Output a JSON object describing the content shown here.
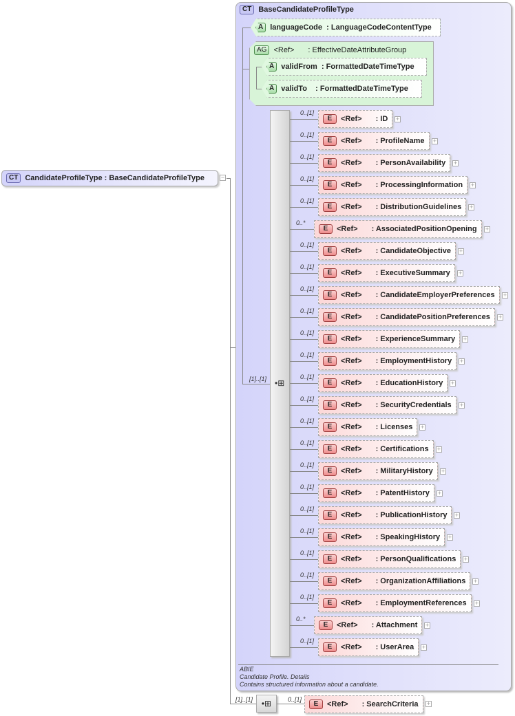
{
  "root": {
    "badge": "CT",
    "name": "CandidateProfileType",
    "type": "BaseCandidateProfileType"
  },
  "complex_type": {
    "badge": "CT",
    "title": "BaseCandidateProfileType"
  },
  "attribute": {
    "badge": "A",
    "name": "languageCode",
    "type": ": LanguageCodeContentType"
  },
  "attribute_group": {
    "badge": "AG",
    "ref": "<Ref>",
    "type": ": EffectiveDateAttributeGroup",
    "attributes": [
      {
        "badge": "A",
        "name": "validFrom",
        "type": ": FormattedDateTimeType"
      },
      {
        "badge": "A",
        "name": "validTo",
        "type": ": FormattedDateTimeType"
      }
    ]
  },
  "sequence": {
    "cardinality": "[1]..[1]"
  },
  "elements": [
    {
      "card": "0..[1]",
      "name": ": ID"
    },
    {
      "card": "0..[1]",
      "name": ": ProfileName"
    },
    {
      "card": "0..[1]",
      "name": ": PersonAvailability"
    },
    {
      "card": "0..[1]",
      "name": ": ProcessingInformation"
    },
    {
      "card": "0..[1]",
      "name": ": DistributionGuidelines"
    },
    {
      "card": "0..*",
      "name": ": AssociatedPositionOpening"
    },
    {
      "card": "0..[1]",
      "name": ": CandidateObjective"
    },
    {
      "card": "0..[1]",
      "name": ": ExecutiveSummary"
    },
    {
      "card": "0..[1]",
      "name": ": CandidateEmployerPreferences"
    },
    {
      "card": "0..[1]",
      "name": ": CandidatePositionPreferences"
    },
    {
      "card": "0..[1]",
      "name": ": ExperienceSummary"
    },
    {
      "card": "0..[1]",
      "name": ": EmploymentHistory"
    },
    {
      "card": "0..[1]",
      "name": ": EducationHistory"
    },
    {
      "card": "0..[1]",
      "name": ": SecurityCredentials"
    },
    {
      "card": "0..[1]",
      "name": ": Licenses"
    },
    {
      "card": "0..[1]",
      "name": ": Certifications"
    },
    {
      "card": "0..[1]",
      "name": ": MilitaryHistory"
    },
    {
      "card": "0..[1]",
      "name": ": PatentHistory"
    },
    {
      "card": "0..[1]",
      "name": ": PublicationHistory"
    },
    {
      "card": "0..[1]",
      "name": ": SpeakingHistory"
    },
    {
      "card": "0..[1]",
      "name": ": PersonQualifications"
    },
    {
      "card": "0..[1]",
      "name": ": OrganizationAffiliations"
    },
    {
      "card": "0..[1]",
      "name": ": EmploymentReferences"
    },
    {
      "card": "0..*",
      "name": ": Attachment"
    },
    {
      "card": "0..[1]",
      "name": ": UserArea"
    }
  ],
  "element_badge": "E",
  "ref_label": "<Ref>",
  "notes": {
    "line1": "ABIE",
    "line2": "Candidate Profile. Details",
    "line3": "Contains structured information about a candidate."
  },
  "outer_sequence": {
    "cardinality": "[1]..[1]",
    "element": {
      "card": "0..[1]",
      "name": ": SearchCriteria"
    }
  }
}
